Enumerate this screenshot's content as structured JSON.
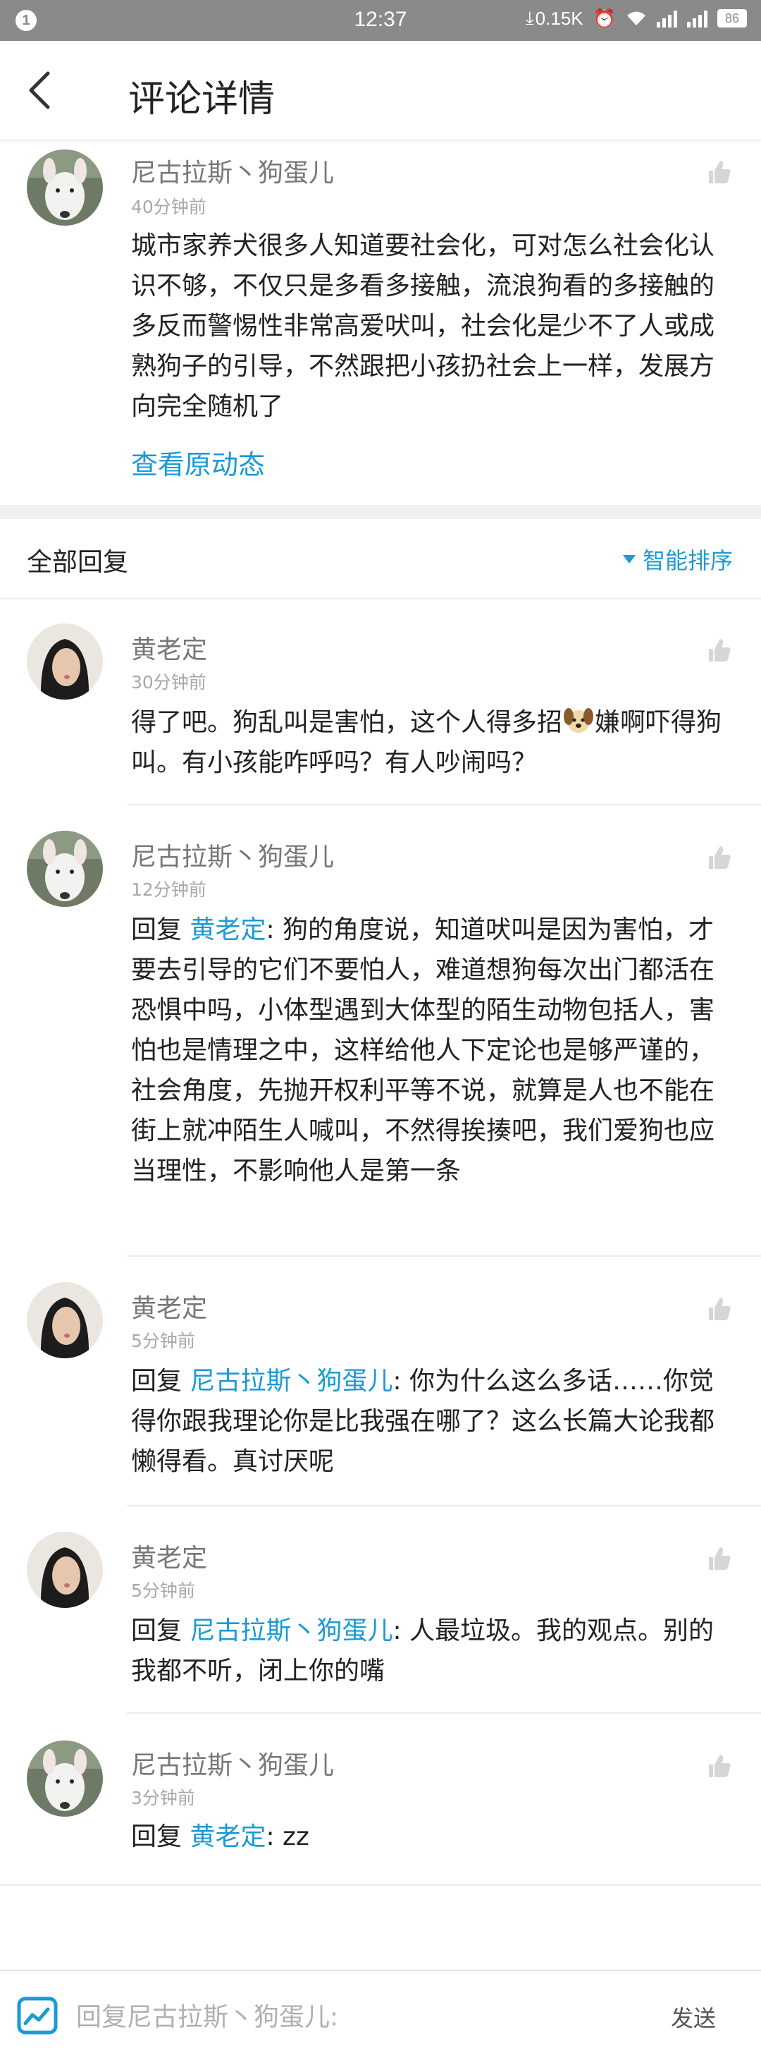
{
  "status_bar": {
    "notification_count": "1",
    "time": "12:37",
    "net_speed": "0.15K",
    "battery": "86"
  },
  "header": {
    "title": "评论详情"
  },
  "main_comment": {
    "user": "尼古拉斯丶狗蛋儿",
    "time": "40分钟前",
    "text": "城市家养犬很多人知道要社会化，可对怎么社会化认识不够，不仅只是多看多接触，流浪狗看的多接触的多反而警惕性非常高爱吠叫，社会化是少不了人或成熟狗子的引导，不然跟把小孩扔社会上一样，发展方向完全随机了",
    "view_original": "查看原动态"
  },
  "replies_header": {
    "title": "全部回复",
    "sort": "智能排序"
  },
  "replies": [
    {
      "user": "黄老定",
      "time": "30分钟前",
      "text_a": "得了吧。狗乱叫是害怕，这个人得多招",
      "text_b": "嫌啊吓得狗叫。有小孩能咋呼吗？有人吵闹吗？"
    },
    {
      "user": "尼古拉斯丶狗蛋儿",
      "time": "12分钟前",
      "reply_prefix": "回复 ",
      "reply_to": "黄老定",
      "text": ": 狗的角度说，知道吠叫是因为害怕，才要去引导的它们不要怕人，难道想狗每次出门都活在恐惧中吗，小体型遇到大体型的陌生动物包括人，害怕也是情理之中，这样给他人下定论也是够严谨的，社会角度，先抛开权利平等不说，就算是人也不能在街上就冲陌生人喊叫，不然得挨揍吧，我们爱狗也应当理性，不影响他人是第一条"
    },
    {
      "user": "黄老定",
      "time": "5分钟前",
      "reply_prefix": "回复 ",
      "reply_to": "尼古拉斯丶狗蛋儿",
      "text": ": 你为什么这么多话……你觉得你跟我理论你是比我强在哪了？这么长篇大论我都懒得看。真讨厌呢"
    },
    {
      "user": "黄老定",
      "time": "5分钟前",
      "reply_prefix": "回复 ",
      "reply_to": "尼古拉斯丶狗蛋儿",
      "text": ": 人最垃圾。我的观点。别的我都不听，闭上你的嘴"
    },
    {
      "user": "尼古拉斯丶狗蛋儿",
      "time": "3分钟前",
      "reply_prefix": "回复 ",
      "reply_to": "黄老定",
      "text": ": zz"
    }
  ],
  "bottom_bar": {
    "placeholder": "回复尼古拉斯丶狗蛋儿:",
    "send": "发送"
  },
  "colors": {
    "accent": "#1a9ad6",
    "status_bar_bg": "#8a8a8a",
    "secondary_text": "#777777"
  }
}
